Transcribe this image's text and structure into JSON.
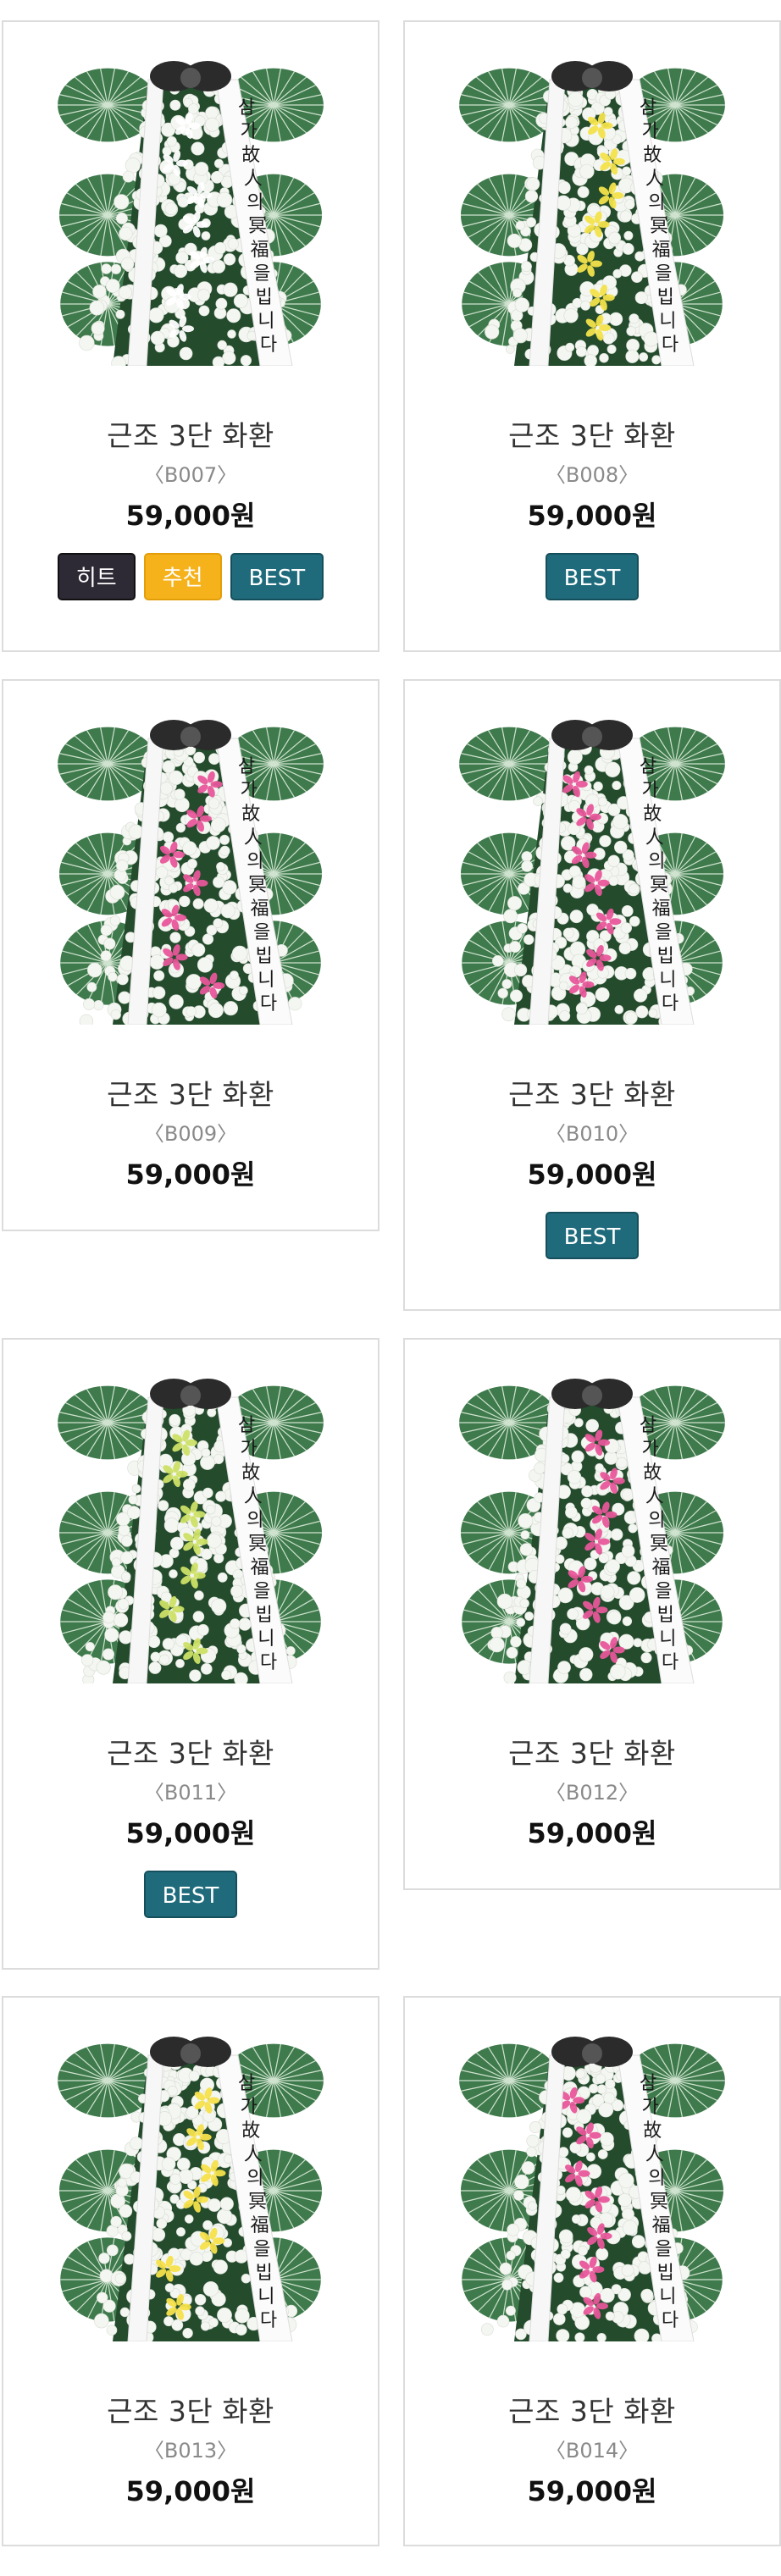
{
  "colors": {
    "badge_hit": "#2e2a35",
    "badge_recommend": "#f5b21a",
    "badge_best": "#1f6b7c",
    "card_border": "#dcdcdc"
  },
  "products": [
    {
      "title": "근조 3단 화환",
      "code": "〈B007〉",
      "price": "59,000원",
      "ribbon": "삼가 故人의 冥福을 빕니다",
      "badges": [
        "히트",
        "추천",
        "BEST"
      ]
    },
    {
      "title": "근조 3단 화환",
      "code": "〈B008〉",
      "price": "59,000원",
      "ribbon": "삼가 故人의 冥福을 빕니다",
      "badges": [
        "BEST"
      ]
    },
    {
      "title": "근조 3단 화환",
      "code": "〈B009〉",
      "price": "59,000원",
      "ribbon": "삼가 故人의 冥福을 빕니다",
      "badges": []
    },
    {
      "title": "근조 3단 화환",
      "code": "〈B010〉",
      "price": "59,000원",
      "ribbon": "삼가 故人의 冥福을 빕니다",
      "badges": [
        "BEST"
      ]
    },
    {
      "title": "근조 3단 화환",
      "code": "〈B011〉",
      "price": "59,000원",
      "ribbon": "삼가 故人의 冥福을 빕니다",
      "badges": [
        "BEST"
      ]
    },
    {
      "title": "근조 3단 화환",
      "code": "〈B012〉",
      "price": "59,000원",
      "ribbon": "삼가 故人의 冥福을 빕니다",
      "badges": []
    },
    {
      "title": "근조 3단 화환",
      "code": "〈B013〉",
      "price": "59,000원",
      "ribbon": "삼가 故人의 冥福을 빕니다",
      "badges": []
    },
    {
      "title": "근조 3단 화환",
      "code": "〈B014〉",
      "price": "59,000원",
      "ribbon": "삼가 故人의 冥福을 빕니다",
      "badges": []
    }
  ]
}
